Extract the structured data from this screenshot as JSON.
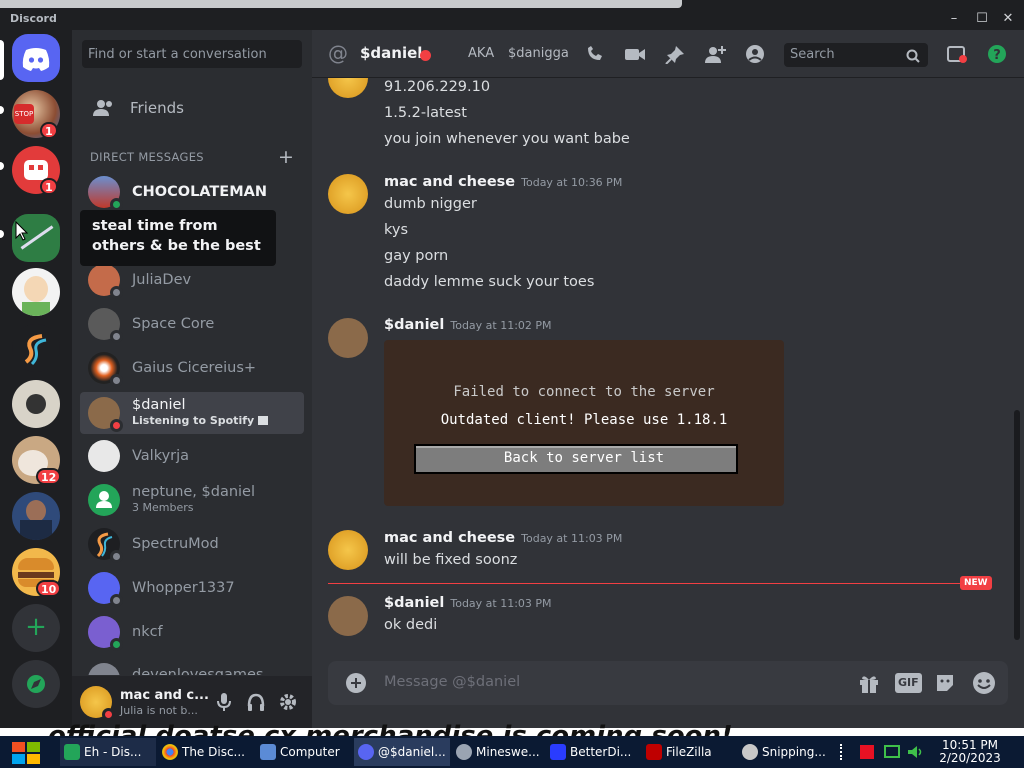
{
  "app": {
    "title": "Discord"
  },
  "window": {
    "minimize": "–",
    "maximize": "☐",
    "close": "✕"
  },
  "guilds": {
    "badges": [
      "1",
      "1",
      "12",
      "10"
    ]
  },
  "dm": {
    "search_placeholder": "Find or start a conversation",
    "friends_label": "Friends",
    "header": "DIRECT MESSAGES",
    "tooltip": "steal time from others & be the best",
    "items": [
      {
        "name": "CHOCOLATEMAN",
        "sub": ""
      },
      {
        "name": "JuliaDev",
        "sub": ""
      },
      {
        "name": "Space Core",
        "sub": ""
      },
      {
        "name": "Gaius Cicereius+",
        "sub": ""
      },
      {
        "name": "$daniel",
        "sub": "Listening to Spotify"
      },
      {
        "name": "Valkyrja",
        "sub": ""
      },
      {
        "name": "neptune, $daniel",
        "sub": "3 Members"
      },
      {
        "name": "SpectruMod",
        "sub": ""
      },
      {
        "name": "Whopper1337",
        "sub": ""
      },
      {
        "name": "nkcf",
        "sub": ""
      },
      {
        "name": "devenlovesgames",
        "sub": ""
      }
    ]
  },
  "user": {
    "name": "mac and c...",
    "status": "Julia is not b..."
  },
  "chat": {
    "at": "@",
    "channel": "$daniel",
    "aka_label": "AKA",
    "aka_value": "$danigga",
    "search_placeholder": "Search",
    "new_label": "NEW",
    "composer_placeholder": "Message @$daniel",
    "gif_label": "GIF",
    "messages": {
      "m0_lines": [
        "91.206.229.10",
        "1.5.2-latest",
        "you join whenever you want babe"
      ],
      "m1_author": "mac and cheese",
      "m1_time": "Today at 10:36 PM",
      "m1_lines": [
        "dumb nigger",
        "kys",
        "gay porn",
        "daddy lemme suck your toes"
      ],
      "m2_author": "$daniel",
      "m2_time": "Today at 11:02 PM",
      "mc_failed": "Failed to connect to the server",
      "mc_outdated": "Outdated client! Please use 1.18.1",
      "mc_back": "Back to server list",
      "m3_author": "mac and cheese",
      "m3_time": "Today at 11:03 PM",
      "m3_lines": [
        "will be fixed soonz"
      ],
      "m4_author": "$daniel",
      "m4_time": "Today at 11:03 PM",
      "m4_lines": [
        "ok dedi"
      ]
    }
  },
  "banner": {
    "text": "official doatse cx merchandise is coming soon!"
  },
  "taskbar": {
    "items": [
      "Eh - Dis...",
      "The Disc...",
      "Computer",
      "@$daniel...",
      "Mineswe...",
      "BetterDi...",
      "FileZilla",
      "Snipping..."
    ],
    "time": "10:51 PM",
    "date": "2/20/2023"
  },
  "colors": {
    "blurple": "#5865f2",
    "red": "#f23f43",
    "green": "#23a559",
    "bg": "#313338"
  }
}
